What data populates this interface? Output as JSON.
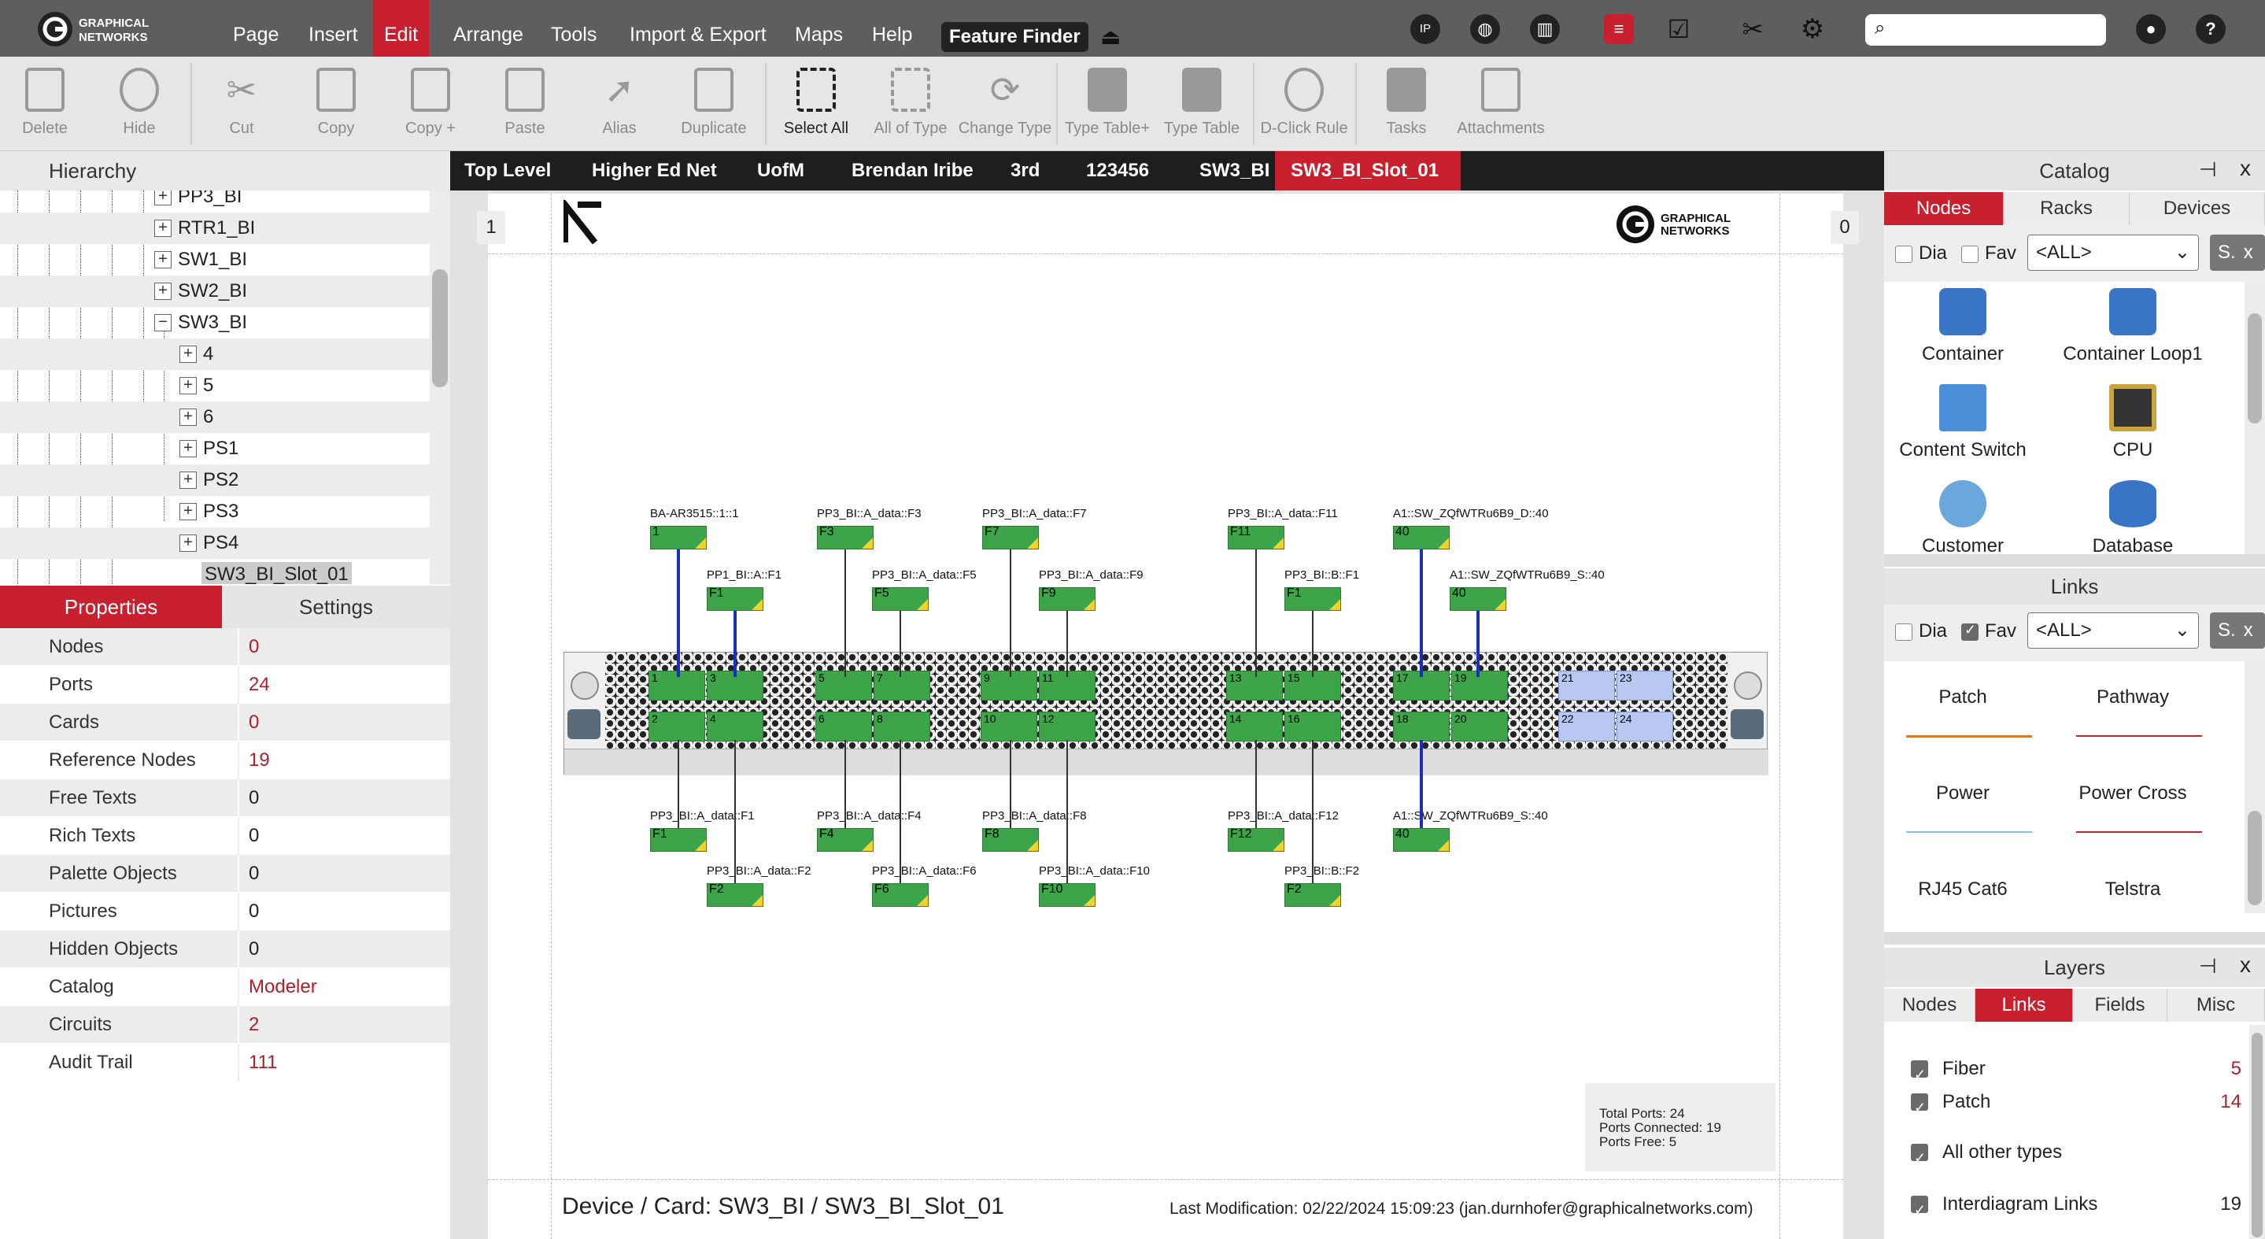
{
  "app": {
    "logo_text": "GRAPHICAL NETWORKS"
  },
  "menu": {
    "items": [
      "Page",
      "Insert",
      "Edit",
      "Arrange",
      "Tools",
      "Import & Export",
      "Maps",
      "Help"
    ],
    "feature_finder": "Feature Finder",
    "icons": [
      "ip-icon",
      "globe-icon",
      "chart-icon",
      "list-icon",
      "check-icon",
      "tools-icon",
      "gear-icon",
      "user-icon",
      "help-icon"
    ]
  },
  "toolbar": {
    "items": [
      "Delete",
      "Hide",
      "Cut",
      "Copy",
      "Copy +",
      "Paste",
      "Alias",
      "Duplicate",
      "Select All",
      "All of Type",
      "Change Type",
      "Type Table+",
      "Type Table",
      "D-Click Rule",
      "Tasks",
      "Attachments"
    ]
  },
  "hierarchy": {
    "title": "Hierarchy",
    "items": [
      "PP3_BI",
      "RTR1_BI",
      "SW1_BI",
      "SW2_BI",
      "SW3_BI",
      "4",
      "5",
      "6",
      "PS1",
      "PS2",
      "PS3",
      "PS4",
      "SW3_BI_Slot_01"
    ]
  },
  "properties": {
    "tabs": [
      "Properties",
      "Settings"
    ],
    "rows": [
      {
        "key": "Nodes",
        "value": "0"
      },
      {
        "key": "Ports",
        "value": "24"
      },
      {
        "key": "Cards",
        "value": "0"
      },
      {
        "key": "Reference Nodes",
        "value": "19"
      },
      {
        "key": "Free Texts",
        "value": "0"
      },
      {
        "key": "Rich Texts",
        "value": "0"
      },
      {
        "key": "Palette Objects",
        "value": "0"
      },
      {
        "key": "Pictures",
        "value": "0"
      },
      {
        "key": "Hidden Objects",
        "value": "0"
      },
      {
        "key": "Catalog",
        "value": "Modeler"
      },
      {
        "key": "Circuits",
        "value": "2"
      },
      {
        "key": "Audit Trail",
        "value": "111"
      }
    ]
  },
  "breadcrumbs": [
    "Top Level",
    "Higher Ed Net",
    "UofM",
    "Brendan Iribe",
    "3rd",
    "123456",
    "SW3_BI",
    "SW3_BI_Slot_01"
  ],
  "diagram": {
    "page_left": "1",
    "page_right": "0",
    "brand": "GRAPHICAL NETWORKS",
    "top_labels": [
      "BA-AR3515::1::1",
      "PP1_BI::A::F1",
      "PP3_BI::A_data::F3",
      "PP3_BI::A_data::F5",
      "PP3_BI::A_data::F7",
      "PP3_BI::A_data::F9",
      "PP3_BI::A_data::F11",
      "PP3_BI::B::F1",
      "A1::SW_ZQfWTRu6B9_D::40",
      "A1::SW_ZQfWTRu6B9_S::40"
    ],
    "top_ports": [
      "1",
      "F1",
      "F3",
      "F5",
      "F7",
      "F9",
      "F11",
      "F1",
      "40",
      "40"
    ],
    "bottom_labels": [
      "PP3_BI::A_data::F1",
      "PP3_BI::A_data::F2",
      "PP3_BI::A_data::F4",
      "PP3_BI::A_data::F6",
      "PP3_BI::A_data::F8",
      "PP3_BI::A_data::F10",
      "PP3_BI::A_data::F12",
      "PP3_BI::B::F2",
      "A1::SW_ZQfWTRu6B9_S::40"
    ],
    "bottom_ports": [
      "F1",
      "F2",
      "F4",
      "F6",
      "F8",
      "F10",
      "F12",
      "F2",
      "40"
    ],
    "module_ports": [
      [
        "1",
        "3",
        "2",
        "4"
      ],
      [
        "5",
        "7",
        "6",
        "8"
      ],
      [
        "9",
        "11",
        "10",
        "12"
      ],
      [
        "13",
        "15",
        "14",
        "16"
      ],
      [
        "17",
        "19",
        "18",
        "20"
      ],
      [
        "21",
        "23",
        "22",
        "24"
      ]
    ],
    "summary": [
      "Total Ports: 24",
      "Ports Connected: 19",
      "Ports Free: 5"
    ],
    "footer_title": "Device / Card: SW3_BI / SW3_BI_Slot_01",
    "footer_mod": "Last Modification: 02/22/2024 15:09:23 (jan.durnhofer@graphicalnetworks.com)"
  },
  "catalog": {
    "title": "Catalog",
    "tabs": [
      "Nodes",
      "Racks",
      "Devices"
    ],
    "dia": "Dia",
    "fav": "Fav",
    "filter": "<ALL>",
    "s_btn": "S.",
    "items": [
      "Container",
      "Container Loop1",
      "Content Switch",
      "CPU",
      "Customer",
      "Database"
    ]
  },
  "links": {
    "title": "Links",
    "dia": "Dia",
    "fav": "Fav",
    "filter": "<ALL>",
    "s_btn": "S.",
    "items": [
      "Patch",
      "Pathway",
      "Power",
      "Power Cross",
      "RJ45 Cat6",
      "Telstra"
    ]
  },
  "layers": {
    "title": "Layers",
    "tabs": [
      "Nodes",
      "Links",
      "Fields",
      "Misc"
    ],
    "rows": [
      {
        "label": "Fiber",
        "count": "5"
      },
      {
        "label": "Patch",
        "count": "14"
      },
      {
        "label": "All other types",
        "count": ""
      },
      {
        "label": "Interdiagram Links",
        "count": "19"
      }
    ]
  },
  "colors": {
    "accent": "#c8202f",
    "menubar": "#5e5e5e",
    "port_green": "#3ea44a",
    "link_blue": "#1a2fbf"
  }
}
